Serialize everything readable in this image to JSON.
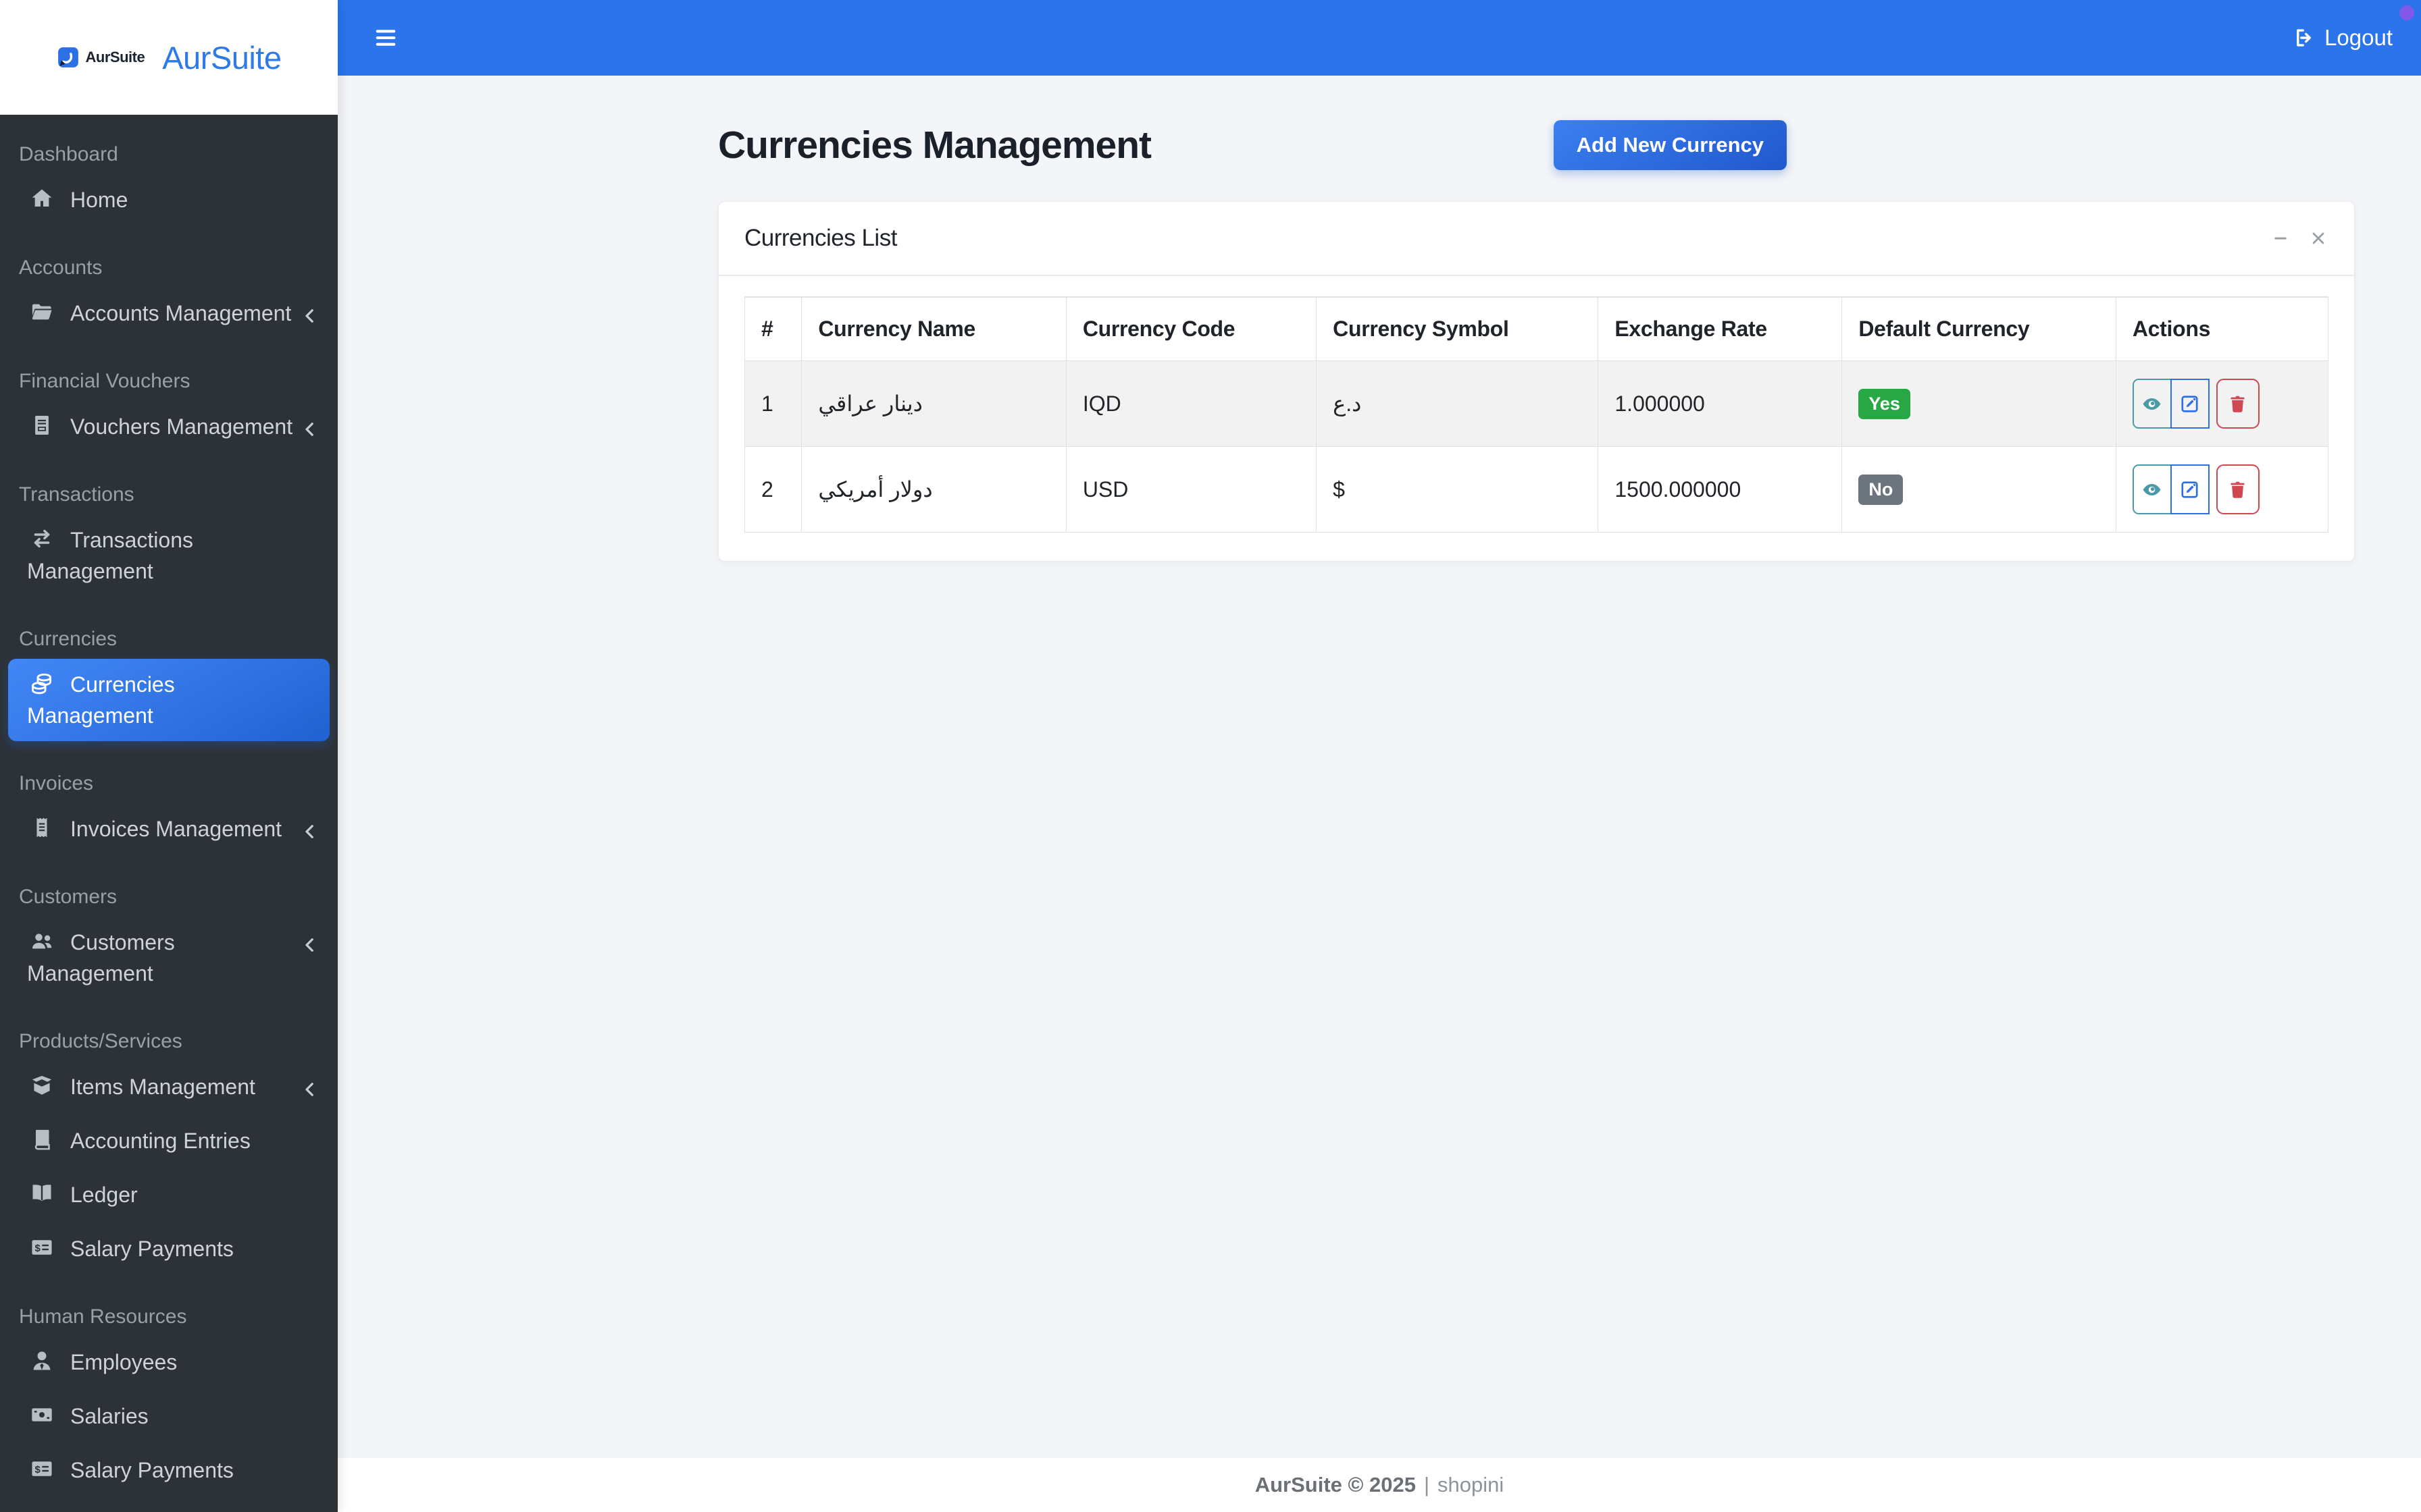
{
  "app": {
    "name": "AurSuite"
  },
  "topbar": {
    "logout_label": "Logout"
  },
  "sidebar": {
    "entries": [
      {
        "type": "section",
        "label": "Dashboard"
      },
      {
        "type": "item",
        "label": "Home",
        "icon": "home"
      },
      {
        "type": "section",
        "label": "Accounts"
      },
      {
        "type": "item",
        "label": "Accounts Management",
        "icon": "folder-open",
        "chevron": true
      },
      {
        "type": "section",
        "label": "Financial Vouchers"
      },
      {
        "type": "item",
        "label": "Vouchers Management",
        "icon": "file-invoice",
        "chevron": true
      },
      {
        "type": "section",
        "label": "Transactions"
      },
      {
        "type": "item",
        "label": "Transactions\nManagement",
        "icon": "exchange"
      },
      {
        "type": "section",
        "label": "Currencies"
      },
      {
        "type": "item",
        "label": "Currencies\nManagement",
        "icon": "coins",
        "active": true
      },
      {
        "type": "section",
        "label": "Invoices"
      },
      {
        "type": "item",
        "label": "Invoices Management",
        "icon": "receipt",
        "chevron": true
      },
      {
        "type": "section",
        "label": "Customers"
      },
      {
        "type": "item",
        "label": "Customers\nManagement",
        "icon": "users",
        "chevron": true
      },
      {
        "type": "section",
        "label": "Products/Services"
      },
      {
        "type": "item",
        "label": "Items Management",
        "icon": "box-open",
        "chevron": true
      },
      {
        "type": "item",
        "label": "Accounting Entries",
        "icon": "book"
      },
      {
        "type": "item",
        "label": "Ledger",
        "icon": "book-open"
      },
      {
        "type": "item",
        "label": "Salary Payments",
        "icon": "money-check"
      },
      {
        "type": "section",
        "label": "Human Resources"
      },
      {
        "type": "item",
        "label": "Employees",
        "icon": "user-tie"
      },
      {
        "type": "item",
        "label": "Salaries",
        "icon": "money-bill"
      },
      {
        "type": "item",
        "label": "Salary Payments",
        "icon": "money-check"
      }
    ]
  },
  "page": {
    "title": "Currencies Management",
    "add_button": "Add New Currency"
  },
  "card": {
    "title": "Currencies List"
  },
  "table": {
    "headers": [
      "#",
      "Currency Name",
      "Currency Code",
      "Currency Symbol",
      "Exchange Rate",
      "Default Currency",
      "Actions"
    ],
    "rows": [
      {
        "num": "1",
        "name": "دينار عراقي",
        "code": "IQD",
        "symbol": "د.ع",
        "rate": "1.000000",
        "default": "Yes"
      },
      {
        "num": "2",
        "name": "دولار أمريكي",
        "code": "USD",
        "symbol": "$",
        "rate": "1500.000000",
        "default": "No"
      }
    ],
    "actions": [
      "view",
      "edit",
      "delete"
    ]
  },
  "footer": {
    "brand": "AurSuite © 2025",
    "divider": "|",
    "site": "shopini"
  },
  "colors": {
    "topbar": "#2c74ec",
    "primary_gradient_start": "#3c80f0",
    "primary_gradient_end": "#2058ce",
    "sidebar_bg": "#2d3237",
    "success": "#28a745",
    "secondary": "#6c757d",
    "info": "#4a9aa7",
    "edit_blue": "#2e6fe8",
    "danger": "#cf4750",
    "content_bg": "#f3f5f8",
    "indicator_dot": "#8158e8"
  }
}
